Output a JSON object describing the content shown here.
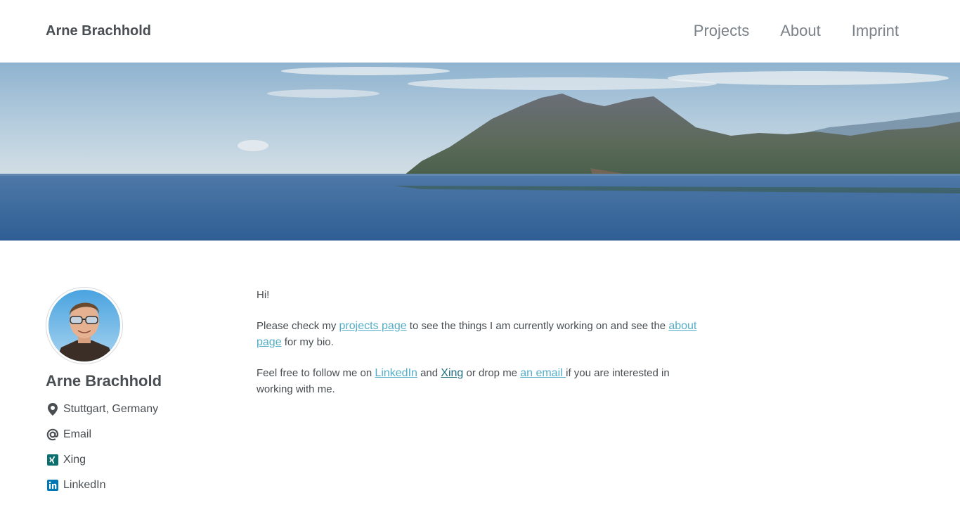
{
  "masthead": {
    "site_title": "Arne Brachhold",
    "nav": [
      {
        "label": "Projects"
      },
      {
        "label": "About"
      },
      {
        "label": "Imprint"
      }
    ]
  },
  "author": {
    "name": "Arne Brachhold",
    "links": [
      {
        "icon": "location-pin-icon",
        "label": "Stuttgart, Germany"
      },
      {
        "icon": "at-sign-icon",
        "label": "Email"
      },
      {
        "icon": "xing-icon",
        "label": "Xing"
      },
      {
        "icon": "linkedin-icon",
        "label": "LinkedIn"
      }
    ]
  },
  "content": {
    "greeting": "Hi!",
    "p2": {
      "t1": "Please check my ",
      "link1": "projects page",
      "t2": " to see the things I am currently working on and see the ",
      "link2": "about page",
      "t3": " for my bio."
    },
    "p3": {
      "t1": "Feel free to follow me on ",
      "link1": "LinkedIn",
      "t2": " and ",
      "link2": "Xing",
      "t3": " or drop me ",
      "link3": "an email ",
      "t4": "if you are interested in working with me."
    }
  },
  "colors": {
    "text": "#494e52",
    "nav_text": "#7a8288",
    "link": "#52adc8",
    "xing": "#0a6f6e",
    "linkedin": "#0077b5"
  }
}
